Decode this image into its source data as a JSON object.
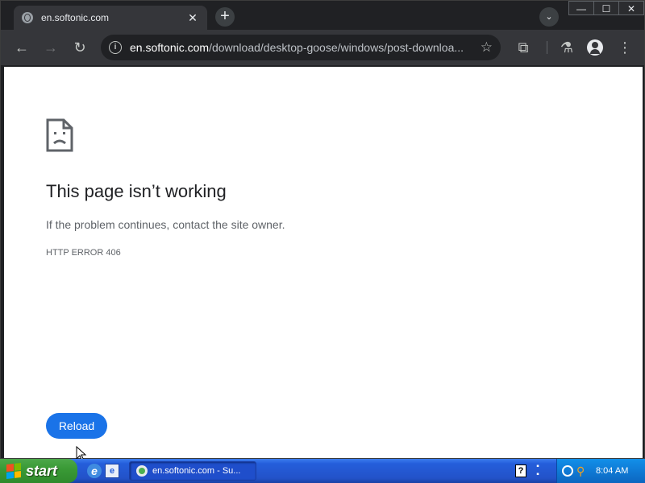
{
  "browser": {
    "tab": {
      "title": "en.softonic.com",
      "close_glyph": "✕"
    },
    "new_tab_glyph": "+",
    "tab_search_glyph": "⌄",
    "window_controls": {
      "minimize": "—",
      "maximize": "☐",
      "close": "✕"
    },
    "toolbar": {
      "back_glyph": "←",
      "forward_glyph": "→",
      "reload_glyph": "↻",
      "url_host": "en.softonic.com",
      "url_path": "/download/desktop-goose/windows/post-downloa...",
      "info_glyph": "i",
      "star_glyph": "☆",
      "extensions_glyph": "⧉",
      "labs_glyph": "⚗",
      "menu_glyph": "⋮"
    }
  },
  "page": {
    "error_title": "This page isn’t working",
    "error_message": "If the problem continues, contact the site owner.",
    "error_code": "HTTP ERROR 406",
    "reload_label": "Reload"
  },
  "taskbar": {
    "start_label": "start",
    "ie_glyph": "e",
    "show_desktop_glyph": "e",
    "task_button_label": "en.softonic.com - Su...",
    "help_glyph": "?",
    "clock": "8:04 AM"
  },
  "colors": {
    "accent": "#1a73e8",
    "browser_frame": "#202124",
    "toolbar": "#35363a",
    "taskbar": "#245edb",
    "start_button": "#3a9a36"
  }
}
